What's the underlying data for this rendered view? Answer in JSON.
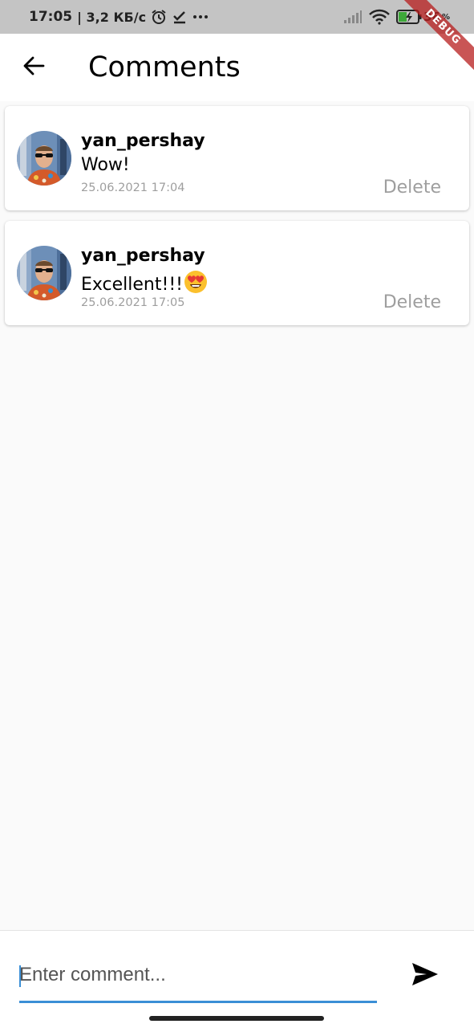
{
  "status_bar": {
    "time": "17:05",
    "network_speed": "| 3,2 КБ/с",
    "battery": "36",
    "battery_unit": "%",
    "icons": [
      "alarm-icon",
      "check-icon",
      "more-icon",
      "signal-icon",
      "wifi-icon",
      "battery-charging-icon"
    ]
  },
  "debug_banner": {
    "label": "DEBUG"
  },
  "app_bar": {
    "back_icon": "arrow-back-icon",
    "title": "Comments"
  },
  "comments": [
    {
      "username": "yan_pershay",
      "text": "Wow!",
      "emoji": "",
      "timestamp": "25.06.2021 17:04",
      "delete_label": "Delete"
    },
    {
      "username": "yan_pershay",
      "text": "Excellent!!!",
      "emoji": "heart-eyes-emoji",
      "timestamp": "25.06.2021 17:05",
      "delete_label": "Delete"
    }
  ],
  "input": {
    "placeholder": "Enter comment...",
    "value": "",
    "send_icon": "send-icon"
  },
  "colors": {
    "accent": "#3b8fd6",
    "muted_text": "#9e9e9e",
    "background": "#fafafa",
    "status_bar": "#c4c4c4"
  }
}
